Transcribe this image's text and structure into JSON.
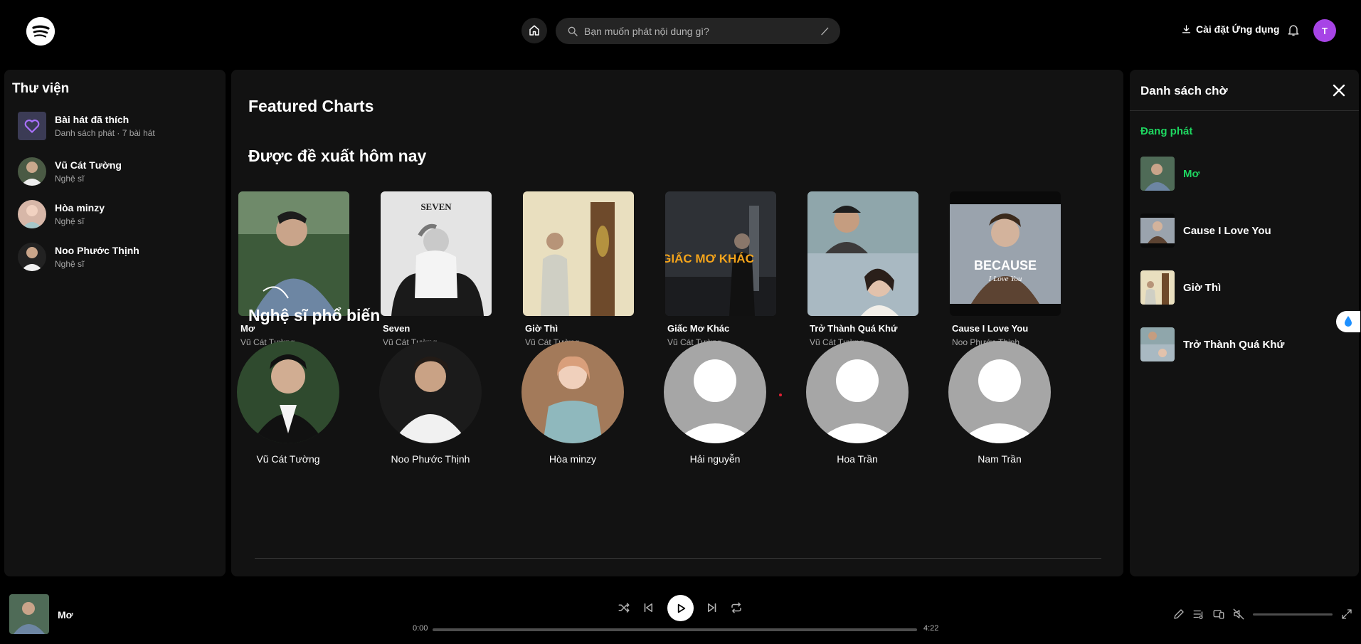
{
  "search": {
    "placeholder": "Bạn muốn phát nội dung gì?"
  },
  "header": {
    "install_label": "Cài đặt Ứng dụng",
    "avatar_initial": "T"
  },
  "library": {
    "title": "Thư viện",
    "items": [
      {
        "name": "Bài hát đã thích",
        "sub": "Danh sách phát · 7 bài hát",
        "icon": "heart-icon"
      },
      {
        "name": "Vũ Cát Tường",
        "sub": "Nghệ sĩ"
      },
      {
        "name": "Hòa minzy",
        "sub": "Nghệ sĩ"
      },
      {
        "name": "Noo Phước Thịnh",
        "sub": "Nghệ sĩ"
      }
    ]
  },
  "main": {
    "featured_title": "Featured Charts",
    "recommended_title": "Được đề xuất hôm nay",
    "songs": [
      {
        "title": "Mơ",
        "artist": "Vũ Cát Tường"
      },
      {
        "title": "Seven",
        "artist": "Vũ Cát Tường"
      },
      {
        "title": "Giờ Thì",
        "artist": "Vũ Cát Tường"
      },
      {
        "title": "Giấc Mơ Khác",
        "artist": "Vũ Cát Tường"
      },
      {
        "title": "Trở Thành Quá Khứ",
        "artist": "Vũ Cát Tường"
      },
      {
        "title": "Cause I Love You",
        "artist": "Noo Phước Thịnh"
      }
    ],
    "cover_texts": {
      "seven": "SEVEN",
      "giacmo": "GIẤC MƠ KHÁC",
      "because": "BECAUSE",
      "iloveyou": "I Love You"
    },
    "popular_title": "Nghệ sĩ phổ biến",
    "artists": [
      {
        "name": "Vũ Cát Tường"
      },
      {
        "name": "Noo Phước Thịnh"
      },
      {
        "name": "Hòa minzy"
      },
      {
        "name": "Hải nguyễn"
      },
      {
        "name": "Hoa Trần"
      },
      {
        "name": "Nam Trần"
      }
    ]
  },
  "queue": {
    "title": "Danh sách chờ",
    "now_playing_label": "Đang phát",
    "items": [
      {
        "name": "Mơ",
        "active": true
      },
      {
        "name": "Cause I Love You"
      },
      {
        "name": "Giờ Thì"
      },
      {
        "name": "Trở Thành Quá Khứ"
      }
    ]
  },
  "player": {
    "track_title": "Mơ",
    "elapsed": "0:00",
    "duration": "4:22",
    "progress": 0
  },
  "colors": {
    "accent": "#1ed760",
    "avatar": "#a744e6",
    "background": "#000000",
    "panel": "#121212"
  }
}
